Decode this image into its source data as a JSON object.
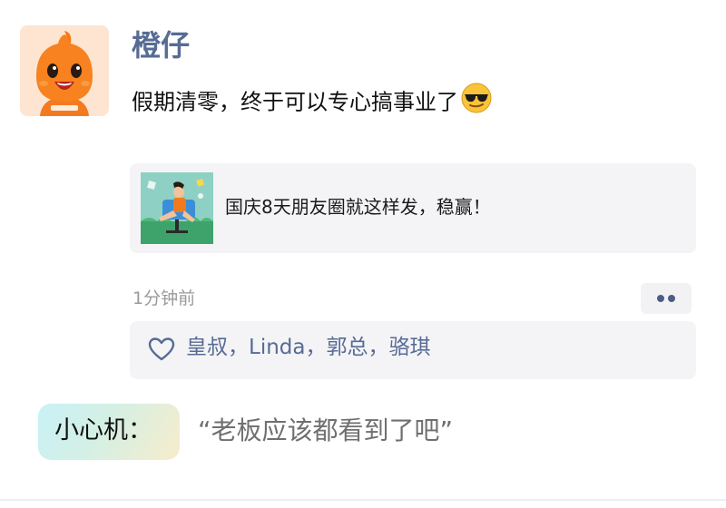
{
  "post": {
    "username": "橙仔",
    "text": "假期清零，终于可以专心搞事业了",
    "emoji": "sunglasses-emoji",
    "avatar_icon": "orange-mascot-icon",
    "accent_color": "#576b95",
    "link_card": {
      "title": "国庆8天朋友圈就这样发，稳赢！",
      "thumbnail_icon": "person-in-chair-thumbnail"
    },
    "timestamp": "1分钟前",
    "more_icon": "more-dots-icon",
    "likes": {
      "icon": "heart-icon",
      "text": "皇叔，Linda，郭总，骆琪"
    }
  },
  "comment": {
    "author": "小心机：",
    "text": "“老板应该都看到了吧”"
  }
}
